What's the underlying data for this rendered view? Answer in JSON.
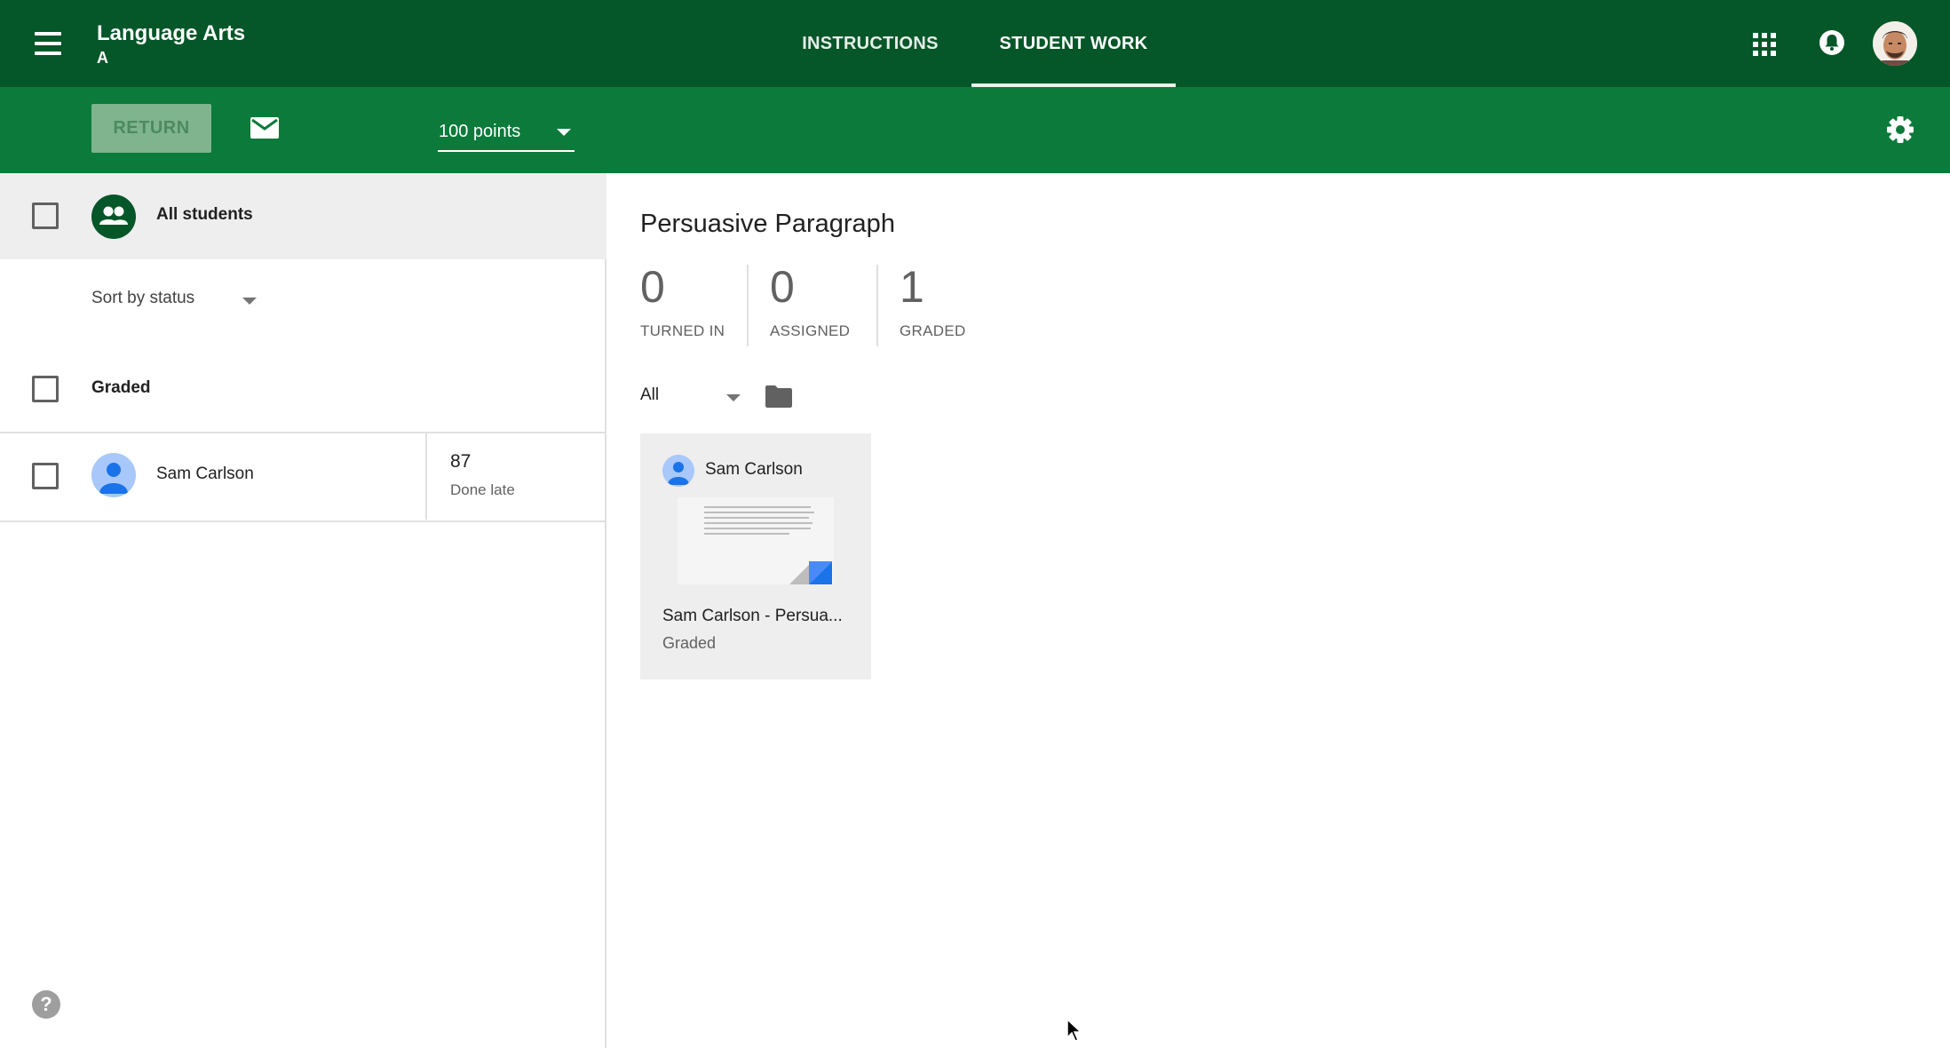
{
  "header": {
    "class_title": "Language Arts",
    "class_section": "A",
    "tabs": [
      {
        "label": "INSTRUCTIONS",
        "active": false
      },
      {
        "label": "STUDENT WORK",
        "active": true
      }
    ],
    "icons": [
      "menu-icon",
      "apps-icon",
      "notifications-icon",
      "account-avatar"
    ],
    "colors": {
      "header_bg": "#055628",
      "toolbar_bg": "#0b7a3a"
    }
  },
  "toolbar": {
    "return_label": "RETURN",
    "points_value": "100 points",
    "icons": [
      "mail-icon",
      "settings-icon"
    ]
  },
  "left_panel": {
    "all_students_label": "All students",
    "sort_label": "Sort by status",
    "group_label": "Graded",
    "students": [
      {
        "name": "Sam Carlson",
        "grade": "87",
        "status": "Done late"
      }
    ]
  },
  "main": {
    "assignment_title": "Persuasive Paragraph",
    "stats": [
      {
        "value": "0",
        "label": "TURNED IN"
      },
      {
        "value": "0",
        "label": "ASSIGNED"
      },
      {
        "value": "1",
        "label": "GRADED"
      }
    ],
    "filter_value": "All",
    "cards": [
      {
        "student_name": "Sam Carlson",
        "file_name": "Sam Carlson - Persua...",
        "status": "Graded"
      }
    ]
  }
}
